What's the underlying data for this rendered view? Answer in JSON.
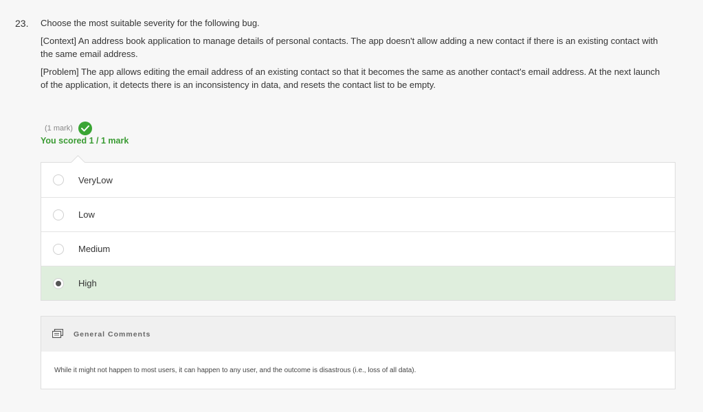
{
  "question": {
    "number": "23.",
    "prompt": "Choose the most suitable severity for the following bug.",
    "context": "[Context] An address book application to manage details of personal contacts. The app doesn't allow adding a new contact if there is an existing contact with the same email address.",
    "problem": "[Problem] The app allows editing the email address of an existing contact so that it becomes the same as another contact's email address. At the next launch of the application, it detects there is an inconsistency in data, and resets the contact list to be empty."
  },
  "marking": {
    "marks": "(1 mark)",
    "score": "You scored 1 / 1 mark",
    "status_icon": "check-circle-icon",
    "success_color": "#3aa534"
  },
  "options": [
    {
      "label": "VeryLow",
      "selected": false
    },
    {
      "label": "Low",
      "selected": false
    },
    {
      "label": "Medium",
      "selected": false
    },
    {
      "label": "High",
      "selected": true
    }
  ],
  "comments": {
    "title": "General Comments",
    "icon": "comment-icon",
    "text": "While it might not happen to most users, it can happen to any user, and the outcome is disastrous (i.e., loss of all data)."
  },
  "colors": {
    "selected_option_bg": "#dfeedd",
    "background": "#f7f7f7"
  }
}
